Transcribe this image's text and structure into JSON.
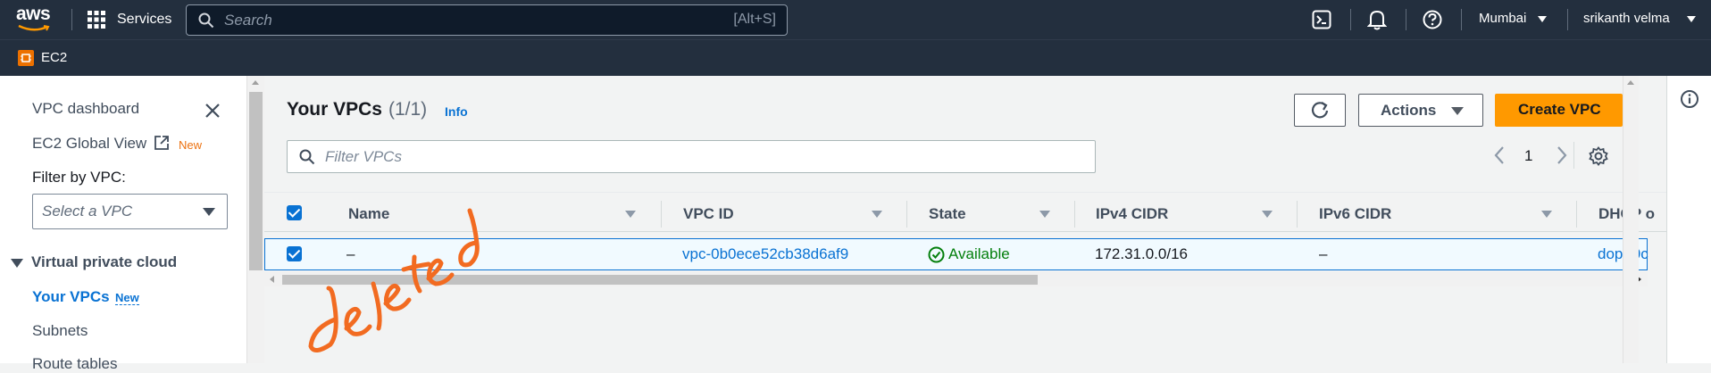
{
  "top_nav": {
    "logo_text": "aws",
    "services_label": "Services",
    "search_placeholder": "Search",
    "search_shortcut": "[Alt+S]",
    "region_label": "Mumbai",
    "user_label": "srikanth velma"
  },
  "service_bar": {
    "service_label": "EC2"
  },
  "sidebar": {
    "dashboard_label": "VPC dashboard",
    "global_view_label": "EC2 Global View",
    "global_view_badge": "New",
    "filter_label": "Filter by VPC:",
    "filter_placeholder": "Select a VPC",
    "section_title": "Virtual private cloud",
    "items": [
      {
        "label": "Your VPCs",
        "badge": "New"
      },
      {
        "label": "Subnets"
      },
      {
        "label": "Route tables"
      }
    ]
  },
  "main": {
    "title": "Your VPCs",
    "count": "(1/1)",
    "info_label": "Info",
    "actions_label": "Actions",
    "create_label": "Create VPC",
    "filter_placeholder": "Filter VPCs",
    "page_number": "1",
    "columns": [
      "Name",
      "VPC ID",
      "State",
      "IPv4 CIDR",
      "IPv6 CIDR",
      "DHCP o"
    ],
    "rows": [
      {
        "name": "–",
        "vpc_id": "vpc-0b0ece52cb38d6af9",
        "state": "Available",
        "ipv4": "172.31.0.0/16",
        "ipv6": "–",
        "dhcp": "dopt-0c"
      }
    ]
  },
  "annotation": {
    "text": "deleted",
    "color": "#f26b21"
  },
  "colors": {
    "accent_orange": "#ff9900",
    "link_blue": "#0972d3",
    "nav_bg": "#232f3e",
    "success_green": "#037f0c"
  }
}
